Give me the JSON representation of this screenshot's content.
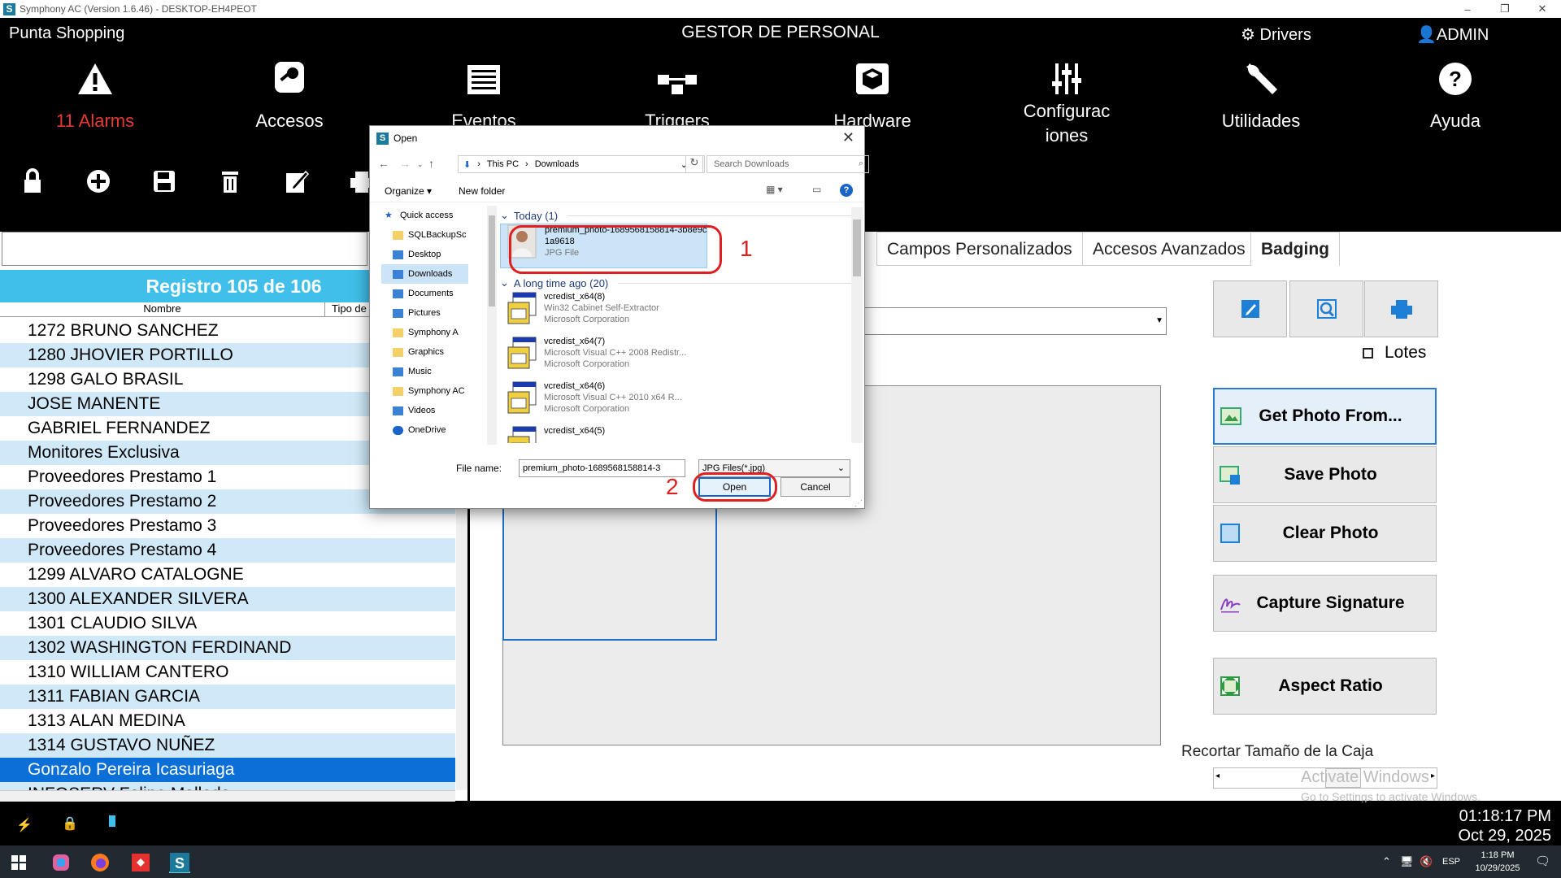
{
  "window": {
    "title": "Symphony AC  (Version 1.6.46) - DESKTOP-EH4PEOT",
    "controls": [
      "–",
      "❐",
      "✕"
    ]
  },
  "header": {
    "site": "Punta Shopping",
    "title": "GESTOR DE PERSONAL",
    "drivers": "Drivers",
    "user": "ADMIN"
  },
  "ribbon": [
    {
      "label": "11 Alarms",
      "icon": "alarm-warning-icon",
      "color": "#e53935"
    },
    {
      "label": "Accesos",
      "icon": "access-key-icon"
    },
    {
      "label": "Eventos",
      "icon": "events-icon"
    },
    {
      "label": "Triggers",
      "icon": "triggers-icon"
    },
    {
      "label": "Hardware",
      "icon": "hardware-box-icon"
    },
    {
      "label": "Configurac iones",
      "icon": "settings-sliders-icon"
    },
    {
      "label": "Utilidades",
      "icon": "wrench-icon"
    },
    {
      "label": "Ayuda",
      "icon": "help-icon"
    }
  ],
  "toolbar": [
    "lock-icon",
    "add-icon",
    "save-icon",
    "delete-icon",
    "edit-icon",
    "print-icon"
  ],
  "list": {
    "record_label": "Registro 105 de 106",
    "columns": [
      "Nombre",
      "Tipo de"
    ],
    "rows": [
      "1272 BRUNO SANCHEZ",
      "1280 JHOVIER PORTILLO",
      "1298 GALO BRASIL",
      "JOSE  MANENTE",
      "GABRIEL FERNANDEZ",
      "Monitores Exclusiva",
      "Proveedores Prestamo 1",
      "Proveedores Prestamo 2",
      "Proveedores Prestamo 3",
      "Proveedores Prestamo 4",
      "1299 ALVARO CATALOGNE",
      "1300 ALEXANDER SILVERA",
      "1301 CLAUDIO SILVA",
      "1302 WASHINGTON FERDINAND",
      "1310 WILLIAM CANTERO",
      "1311 FABIAN GARCIA",
      "1313 ALAN MEDINA",
      "1314 GUSTAVO NUÑEZ",
      "Gonzalo Pereira Icasuriaga",
      "INFOSERV Felipe Malleda"
    ],
    "selected_index": 18
  },
  "tabs": [
    "Campos Personalizados",
    "Accesos Avanzados",
    "Badging"
  ],
  "badging": {
    "lotes_label": "Lotes",
    "buttons": [
      "Get Photo From...",
      "Save Photo",
      "Clear Photo",
      "Capture Signature",
      "Aspect Ratio"
    ],
    "recortar": "Recortar Tamaño de la Caja",
    "activate1": "Activate Windows",
    "activate2": "Go to Settings to activate Windows."
  },
  "status": {
    "time": "01:18:17 PM",
    "date": "Oct 29, 2025"
  },
  "tray": {
    "lang": "ESP",
    "time": "1:18 PM",
    "date": "10/29/2025"
  },
  "dialog": {
    "title": "Open",
    "path": [
      "This PC",
      "Downloads"
    ],
    "search_placeholder": "Search Downloads",
    "organize": "Organize",
    "new_folder": "New folder",
    "nav": [
      "Quick access",
      "SQLBackupSc",
      "Desktop",
      "Downloads",
      "Documents",
      "Pictures",
      "Symphony A",
      "Graphics",
      "Music",
      "Symphony AC",
      "Videos",
      "OneDrive"
    ],
    "group_today": "Today (1)",
    "group_old": "A long time ago (20)",
    "files": [
      {
        "name": "premium_photo-1689568158814-3b8e9c1a9618",
        "type": "JPG File",
        "company": ""
      },
      {
        "name": "vcredist_x64(8)",
        "type": "Win32 Cabinet Self-Extractor",
        "company": "Microsoft Corporation"
      },
      {
        "name": "vcredist_x64(7)",
        "type": "Microsoft Visual C++ 2008 Redistr...",
        "company": "Microsoft Corporation"
      },
      {
        "name": "vcredist_x64(6)",
        "type": "Microsoft Visual C++ 2010  x64 R...",
        "company": "Microsoft Corporation"
      },
      {
        "name": "vcredist_x64(5)",
        "type": "",
        "company": ""
      }
    ],
    "file_name_label": "File name:",
    "file_name_value": "premium_photo-1689568158814-3",
    "file_type": "JPG Files(*.jpg)",
    "open": "Open",
    "cancel": "Cancel",
    "marker1": "1",
    "marker2": "2"
  }
}
